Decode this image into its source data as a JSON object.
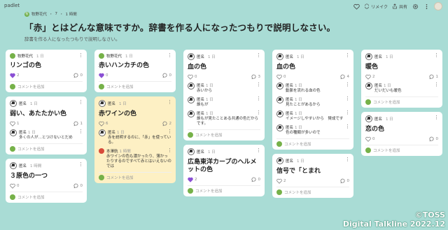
{
  "app": {
    "brand": "padlet"
  },
  "toolbar": {
    "remake": "リメイク",
    "share": "共有"
  },
  "header": {
    "author": "牧野花代",
    "dot": "・",
    "count": "7",
    "time": "1 時間",
    "title": "「赤」とはどんな意味ですか。辞書を作る人になったつもりで説明しなさい。",
    "subtitle": "辞書を作る人になったつもりで説明しなさい。"
  },
  "common": {
    "add_comment": "コメントを追加",
    "anon": "匿名"
  },
  "columns": [
    {
      "cards": [
        {
          "author": "牧野花代",
          "ago": "1 日",
          "title": "リンゴの色",
          "likes": "2",
          "comments": "0",
          "liked": true,
          "avatar": "green",
          "comment_list": []
        },
        {
          "author": "匿名",
          "ago": "1 日",
          "title": "弱い、あたたかい色",
          "likes": "1",
          "comments": "1",
          "liked": false,
          "avatar": "anon",
          "comment_list": [
            {
              "author": "匿名",
              "ago": "1 日",
              "text": "多くの人が…とつけないとだめ"
            }
          ]
        },
        {
          "author": "匿名",
          "ago": "1 時間",
          "title": "３原色の一つ",
          "likes": "0",
          "comments": "0",
          "liked": false,
          "avatar": "anon",
          "comment_list": []
        }
      ]
    },
    {
      "cards": [
        {
          "author": "牧野花代",
          "ago": "1 日",
          "title": "赤いハンカチの色",
          "likes": "0",
          "comments": "0",
          "liked": true,
          "avatar": "green",
          "comment_list": []
        },
        {
          "author": "匿名",
          "ago": "1 日",
          "title": "赤ワインの色",
          "likes": "6",
          "comments": "2",
          "liked": false,
          "avatar": "anon",
          "yellow": true,
          "comment_list": [
            {
              "author": "匿名",
              "ago": "1 日",
              "text": "赤を説明するのに、「赤」を使っている。",
              "avatar": "anon"
            },
            {
              "author": "本澤航",
              "ago": "1 時間",
              "text": "赤ワインの色も濃かったり、薄かったりするのですべて赤とはいえないのでは",
              "avatar": "red"
            }
          ]
        }
      ]
    },
    {
      "cards": [
        {
          "author": "匿名",
          "ago": "1 日",
          "title": "血の色",
          "likes": "0",
          "comments": "3",
          "liked": false,
          "avatar": "anon",
          "comment_list": [
            {
              "author": "匿名",
              "ago": "1 日",
              "text": "赤いから"
            },
            {
              "author": "匿名",
              "ago": "1 日",
              "text": "誰もが"
            },
            {
              "author": "匿名",
              "ago": "1 日",
              "text": "誰もが見たことある共通の色だからです。"
            }
          ]
        },
        {
          "author": "匿名",
          "ago": "1 日",
          "title": "広島東洋カープのヘルメットの色",
          "likes": "2",
          "comments": "0",
          "liked": true,
          "avatar": "anon",
          "comment_list": []
        }
      ]
    },
    {
      "cards": [
        {
          "author": "匿名",
          "ago": "1 日",
          "title": "血の色",
          "likes": "0",
          "comments": "4",
          "liked": false,
          "avatar": "anon",
          "comment_list": [
            {
              "author": "匿名",
              "ago": "1 日",
              "text": "動脈を流れる血の色"
            },
            {
              "author": "匿名",
              "ago": "1 日",
              "text": "見たことがあるから"
            },
            {
              "author": "匿名",
              "ago": "1 日",
              "text": "イメージしやすいから　賛成です"
            },
            {
              "author": "匿名",
              "ago": "1 日",
              "text": "色の種類が多いので"
            }
          ]
        },
        {
          "author": "匿名",
          "ago": "1 日",
          "title": "信号で「とまれ",
          "likes": "2",
          "comments": "0",
          "liked": false,
          "avatar": "anon",
          "comment_list": []
        }
      ]
    },
    {
      "cards": [
        {
          "author": "匿名",
          "ago": "1 日",
          "title": "暖色",
          "likes": "2",
          "comments": "1",
          "liked": false,
          "avatar": "anon",
          "comment_list": [
            {
              "author": "匿名",
              "ago": "1 日",
              "text": "だいだいも暖色"
            }
          ]
        },
        {
          "author": "匿名",
          "ago": "1 日",
          "title": "恋の色",
          "likes": "0",
          "comments": "0",
          "liked": false,
          "avatar": "anon",
          "comment_list": []
        }
      ]
    }
  ],
  "watermark": {
    "line1": "©TOSS",
    "line2": "Digital Talkline 2022.12"
  },
  "colors": {
    "background": "#a9dcd5",
    "like": "#8a4fd4",
    "card_highlight": "#fdf0c4"
  }
}
